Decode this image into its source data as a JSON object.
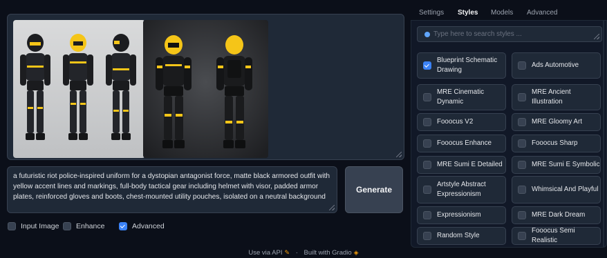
{
  "prompt": {
    "text": "a futuristic riot police-inspired uniform for a dystopian antagonist force, matte black armored outfit with yellow accent lines and markings, full-body tactical gear including helmet with visor, padded armor plates, reinforced gloves and boots, chest-mounted utility pouches, isolated on a neutral background"
  },
  "generate_label": "Generate",
  "options": [
    {
      "label": "Input Image",
      "checked": false
    },
    {
      "label": "Enhance",
      "checked": false
    },
    {
      "label": "Advanced",
      "checked": true
    }
  ],
  "footer": {
    "api_label": "Use via API",
    "built_label": "Built with Gradio",
    "separator": "·"
  },
  "tabs": [
    "Settings",
    "Styles",
    "Models",
    "Advanced"
  ],
  "active_tab": "Styles",
  "search": {
    "placeholder": "Type here to search styles ..."
  },
  "styles": [
    {
      "label": "Blueprint Schematic Drawing",
      "checked": true
    },
    {
      "label": "Ads Automotive",
      "checked": false
    },
    {
      "label": "MRE Cinematic Dynamic",
      "checked": false
    },
    {
      "label": "MRE Ancient Illustration",
      "checked": false
    },
    {
      "label": "Fooocus V2",
      "checked": false
    },
    {
      "label": "MRE Gloomy Art",
      "checked": false
    },
    {
      "label": "Fooocus Enhance",
      "checked": false
    },
    {
      "label": "Fooocus Sharp",
      "checked": false
    },
    {
      "label": "MRE Sumi E Detailed",
      "checked": false
    },
    {
      "label": "MRE Sumi E Symbolic",
      "checked": false
    },
    {
      "label": "Artstyle Abstract Expressionism",
      "checked": false
    },
    {
      "label": "Whimsical And Playful",
      "checked": false
    },
    {
      "label": "Expressionism",
      "checked": false
    },
    {
      "label": "MRE Dark Dream",
      "checked": false
    },
    {
      "label": "Random Style",
      "checked": false
    },
    {
      "label": "Fooocus Semi Realistic",
      "checked": false
    }
  ],
  "colors": {
    "accent": "#3b82f6",
    "armor_yellow": "#f5c518",
    "background": "#0b0f19"
  }
}
